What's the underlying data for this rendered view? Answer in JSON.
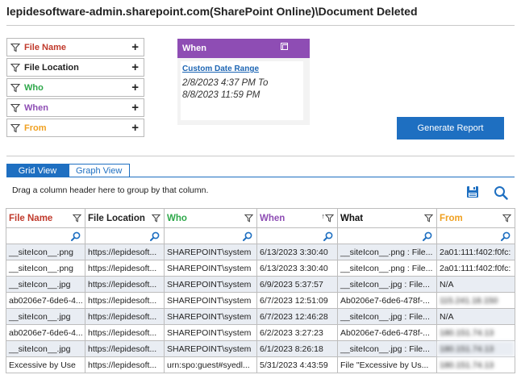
{
  "title": "lepidesoftware-admin.sharepoint.com(SharePoint Online)\\Document Deleted",
  "colors": {
    "file_name": "#c0392b",
    "file_location": "#222222",
    "who": "#2ea84a",
    "when": "#8e4db4",
    "from": "#f0a020",
    "accent": "#1e6fc1"
  },
  "filters": [
    {
      "label": "File Name",
      "color": "#c0392b",
      "action": "+"
    },
    {
      "label": "File Location",
      "color": "#222222",
      "action": "+"
    },
    {
      "label": "Who",
      "color": "#2ea84a",
      "action": "+"
    },
    {
      "label": "When",
      "color": "#8e4db4",
      "action": "+"
    },
    {
      "label": "From",
      "color": "#f0a020",
      "action": "+"
    }
  ],
  "when_panel": {
    "title": "When",
    "link": "Custom Date Range",
    "range_line1": "2/8/2023 4:37 PM To",
    "range_line2": "8/8/2023 11:59 PM"
  },
  "generate_button": "Generate Report",
  "tabs": [
    {
      "label": "Grid View",
      "active": true
    },
    {
      "label": "Graph View",
      "active": false
    }
  ],
  "drag_hint": "Drag a column header here to group by that column.",
  "icons": {
    "save": "save-icon",
    "search": "search-icon",
    "filter": "funnel-icon"
  },
  "grid": {
    "columns": [
      {
        "label": "File Name",
        "color": "#c0392b"
      },
      {
        "label": "File Location",
        "color": "#222222"
      },
      {
        "label": "Who",
        "color": "#2ea84a"
      },
      {
        "label": "When",
        "color": "#8e4db4"
      },
      {
        "label": "What",
        "color": "#111111"
      },
      {
        "label": "From",
        "color": "#f0a020"
      }
    ],
    "when_sort": "↑",
    "rows": [
      [
        "__siteIcon__.png",
        "https://lepidesoft...",
        "SHAREPOINT\\system",
        "6/13/2023 3:30:40",
        "__siteIcon__.png : File...",
        "2a01:111:f402:f0fc:"
      ],
      [
        "__siteIcon__.png",
        "https://lepidesoft...",
        "SHAREPOINT\\system",
        "6/13/2023 3:30:40",
        "__siteIcon__.png : File...",
        "2a01:111:f402:f0fc:"
      ],
      [
        "__siteIcon__.jpg",
        "https://lepidesoft...",
        "SHAREPOINT\\system",
        "6/9/2023 5:37:57",
        "__siteIcon__.jpg : File...",
        "N/A"
      ],
      [
        "ab0206e7-6de6-4...",
        "https://lepidesoft...",
        "SHAREPOINT\\system",
        "6/7/2023 12:51:09",
        "Ab0206e7-6de6-478f-...",
        "115.241.18.150"
      ],
      [
        "__siteIcon__.jpg",
        "https://lepidesoft...",
        "SHAREPOINT\\system",
        "6/7/2023 12:46:28",
        "__siteIcon__.jpg : File...",
        "N/A"
      ],
      [
        "ab0206e7-6de6-4...",
        "https://lepidesoft...",
        "SHAREPOINT\\system",
        "6/2/2023 3:27:23",
        "Ab0206e7-6de6-478f-...",
        "180.151.74.13"
      ],
      [
        "__siteIcon__.jpg",
        "https://lepidesoft...",
        "SHAREPOINT\\system",
        "6/1/2023 8:26:18",
        "__siteIcon__.jpg : File...",
        "180.151.74.13"
      ],
      [
        "Excessive by Use",
        "https://lepidesoft...",
        "urn:spo:guest#syedl...",
        "5/31/2023 4:43:59",
        "File \"Excessive by Us...",
        "180.151.74.13"
      ]
    ]
  }
}
